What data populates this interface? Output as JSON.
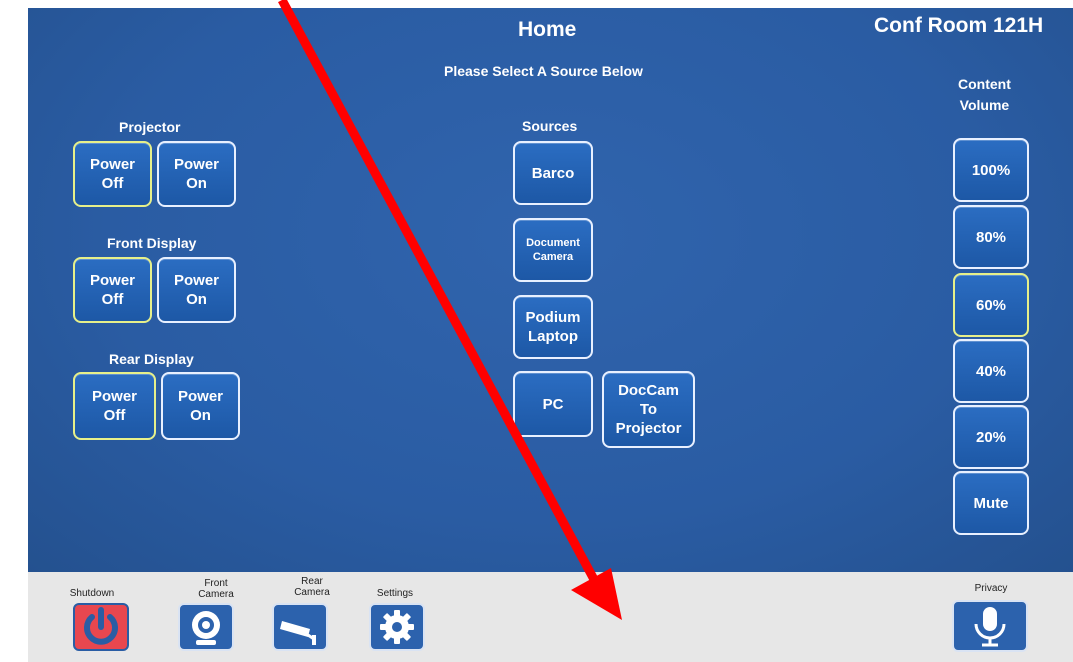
{
  "header": {
    "title": "Home",
    "room": "Conf Room 121H",
    "prompt": "Please Select A Source Below"
  },
  "projector": {
    "label": "Projector",
    "power_off": "Power\nOff",
    "power_on": "Power\nOn"
  },
  "front_display": {
    "label": "Front Display",
    "power_off": "Power\nOff",
    "power_on": "Power\nOn"
  },
  "rear_display": {
    "label": "Rear Display",
    "power_off": "Power\nOff",
    "power_on": "Power\nOn"
  },
  "sources": {
    "label": "Sources",
    "barco": "Barco",
    "document_camera": "Document\nCamera",
    "podium_laptop": "Podium\nLaptop",
    "pc": "PC",
    "doccam_to_projector": "DocCam\nTo\nProjector"
  },
  "volume": {
    "label": "Content\nVolume",
    "levels": [
      "100%",
      "80%",
      "60%",
      "40%",
      "20%"
    ],
    "selected": "60%",
    "mute": "Mute"
  },
  "footer": {
    "shutdown": "Shutdown",
    "front_camera": "Front\nCamera",
    "rear_camera": "Rear\nCamera",
    "settings": "Settings",
    "privacy": "Privacy"
  },
  "icons": {
    "shutdown": "power-icon",
    "front_camera": "webcam-icon",
    "rear_camera": "security-camera-icon",
    "settings": "gear-icon",
    "privacy": "microphone-icon"
  },
  "colors": {
    "background": "#2a5da4",
    "button": "#2266b8",
    "selected_border": "#e6f08a",
    "annotation_arrow": "#ff0000",
    "shutdown": "#e63946"
  }
}
